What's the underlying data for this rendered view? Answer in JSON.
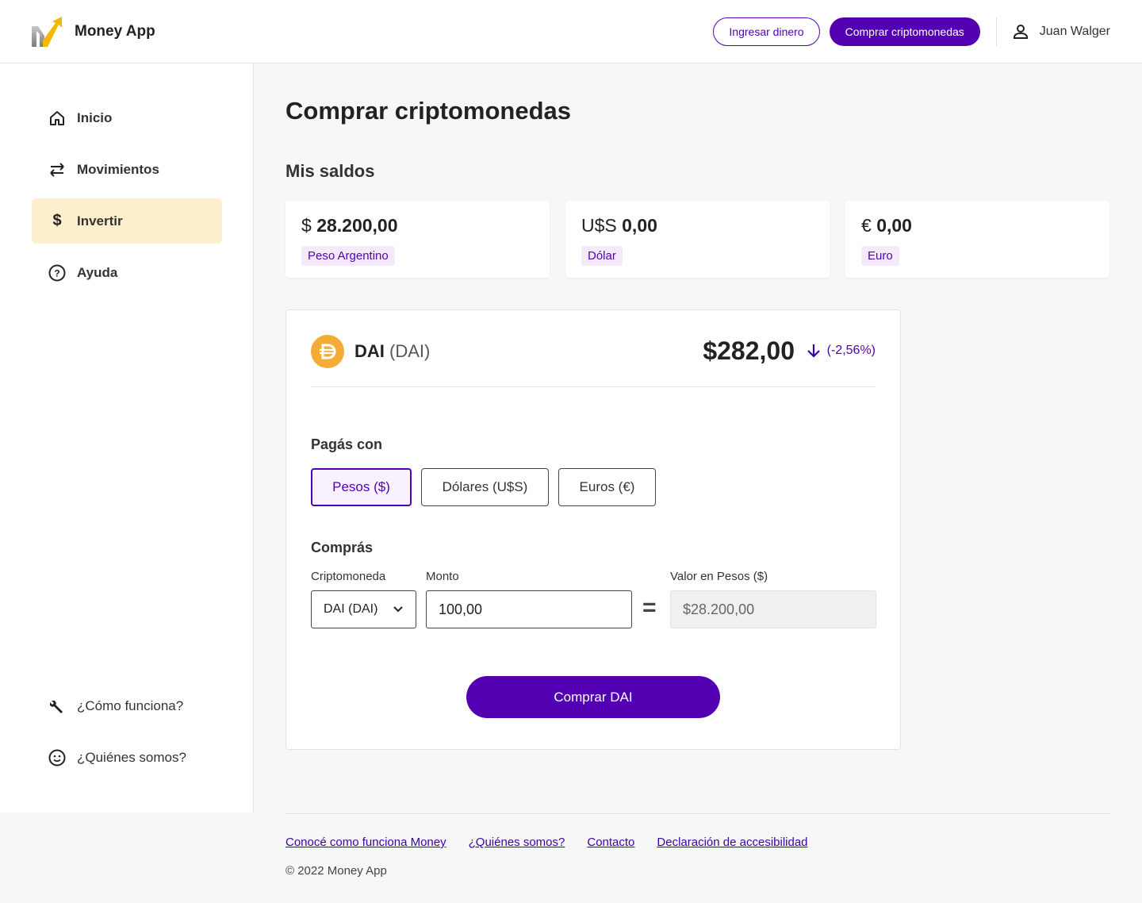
{
  "header": {
    "app_name": "Money App",
    "deposit_label": "Ingresar dinero",
    "buy_crypto_label": "Comprar criptomonedas",
    "user_name": "Juan Walger"
  },
  "sidebar": {
    "items": [
      {
        "label": "Inicio",
        "icon": "home-icon"
      },
      {
        "label": "Movimientos",
        "icon": "swap-arrows-icon"
      },
      {
        "label": "Invertir",
        "icon": "dollar-icon"
      },
      {
        "label": "Ayuda",
        "icon": "help-circle-icon"
      }
    ],
    "bottom_items": [
      {
        "label": "¿Cómo funciona?",
        "icon": "wrench-icon"
      },
      {
        "label": "¿Quiénes somos?",
        "icon": "smiley-icon"
      }
    ]
  },
  "main": {
    "title": "Comprar criptomonedas",
    "balances_title": "Mis saldos",
    "balances": [
      {
        "symbol": "$",
        "amount": "28.200,00",
        "currency": "Peso Argentino"
      },
      {
        "symbol": "U$S",
        "amount": "0,00",
        "currency": "Dólar"
      },
      {
        "symbol": "€",
        "amount": "0,00",
        "currency": "Euro"
      }
    ],
    "coin": {
      "name": "DAI",
      "symbol": "(DAI)",
      "price": "$282,00",
      "change": "(-2,56%)"
    },
    "pay_with_title": "Pagás con",
    "pay_options": [
      "Pesos ($)",
      "Dólares (U$S)",
      "Euros (€)"
    ],
    "buy_title": "Comprás",
    "crypto_label": "Criptomoneda",
    "crypto_selected": "DAI (DAI)",
    "amount_label": "Monto",
    "amount_value": "100,00",
    "value_label": "Valor en Pesos ($)",
    "value_amount": "$28.200,00",
    "buy_button": "Comprar DAI"
  },
  "footer": {
    "links": [
      "Conocé como funciona Money",
      "¿Quiénes somos?",
      "Contacto",
      "Declaración de accesibilidad"
    ],
    "copyright": "© 2022 Money App"
  },
  "colors": {
    "accent": "#5200b2",
    "active_nav_bg": "#fcefcb",
    "coin": "#f5ac37"
  }
}
